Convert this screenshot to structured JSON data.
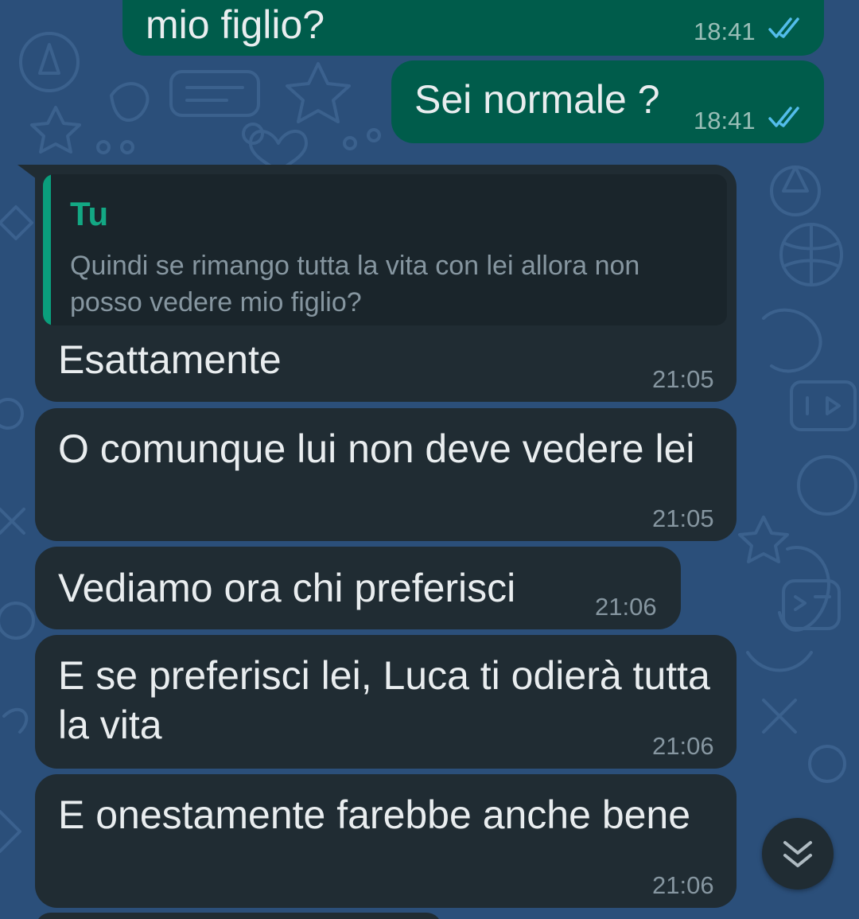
{
  "colors": {
    "chat_background": "#2b4f7a",
    "outgoing_bubble": "#005c4b",
    "incoming_bubble": "#202c33",
    "read_ticks": "#53bdeb",
    "quote_accent": "#13a884"
  },
  "messages": {
    "out_1": {
      "text": "mio figlio?",
      "time": "18:41",
      "status_icon": "double-check-read-icon"
    },
    "out_2": {
      "text": "Sei normale ?",
      "time": "18:41",
      "status_icon": "double-check-read-icon"
    },
    "in_1": {
      "quote_author": "Tu",
      "quote_text": "Quindi se rimango tutta la vita con lei allora non posso vedere mio figlio?",
      "text": "Esattamente",
      "time": "21:05"
    },
    "in_2": {
      "text": "O comunque lui non deve vedere lei",
      "time": "21:05"
    },
    "in_3": {
      "text": "Vediamo ora chi preferisci",
      "time": "21:06"
    },
    "in_4": {
      "text": "E se preferisci lei, Luca ti odierà tutta la vita",
      "time": "21:06"
    },
    "in_5": {
      "text": "E onestamente farebbe anche bene",
      "time": "21:06"
    }
  },
  "scroll_button": {
    "icon": "double-chevron-down-icon"
  }
}
